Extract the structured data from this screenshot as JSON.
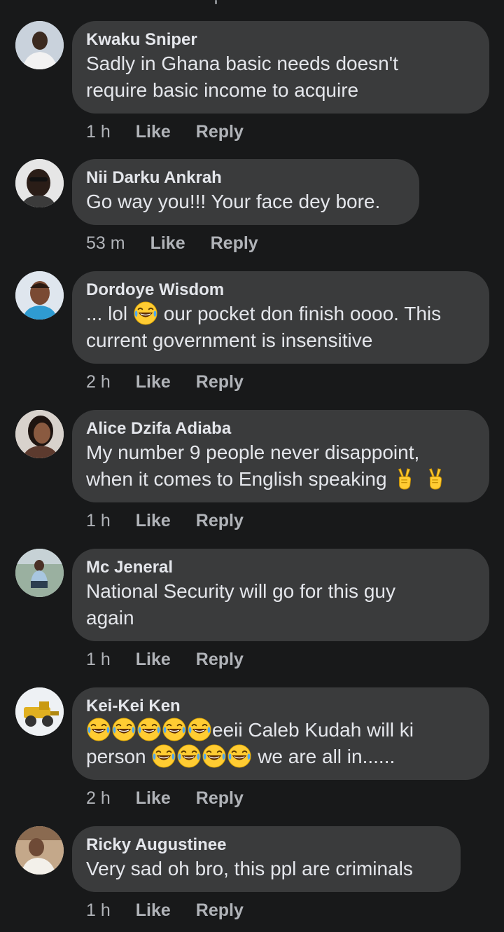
{
  "comments": [
    {
      "author": "Kwaku Sniper",
      "text_lines": [
        "Sadly in Ghana basic needs doesn't",
        "require basic income to acquire"
      ],
      "time": "1 h",
      "like": "Like",
      "reply": "Reply"
    },
    {
      "author": "Nii Darku Ankrah",
      "text_lines": [
        "Go way you!!! Your face dey bore."
      ],
      "time": "53 m",
      "like": "Like",
      "reply": "Reply"
    },
    {
      "author": "Dordoye Wisdom",
      "text_parts": [
        "... lol",
        "our pocket don finish oooo. This"
      ],
      "text_line2": "current government is insensitive",
      "time": "2 h",
      "like": "Like",
      "reply": "Reply"
    },
    {
      "author": "Alice Dzifa Adiaba",
      "text_line1": "My number 9 people never disappoint,",
      "text_line2": "when it comes to English speaking",
      "time": "1 h",
      "like": "Like",
      "reply": "Reply"
    },
    {
      "author": "Mc Jeneral",
      "text_lines": [
        "National Security will go for this guy",
        "again"
      ],
      "time": "1 h",
      "like": "Like",
      "reply": "Reply"
    },
    {
      "author": "Kei-Kei Ken",
      "text_line1_tail": "eeii Caleb Kudah will ki",
      "text_line2_head": "person",
      "text_line2_tail": "we are all in......",
      "time": "2 h",
      "like": "Like",
      "reply": "Reply"
    },
    {
      "author": "Ricky Augustinee",
      "text_lines": [
        "Very sad oh bro, this ppl are criminals"
      ],
      "time": "1 h",
      "like": "Like",
      "reply": "Reply"
    }
  ],
  "icons": {
    "laughing": "face-with-tears-of-joy-icon",
    "victory": "victory-hand-icon"
  },
  "colors": {
    "background": "#18191a",
    "bubble": "#3a3b3c",
    "text": "#e4e6eb",
    "meta": "#b0b3b8"
  }
}
